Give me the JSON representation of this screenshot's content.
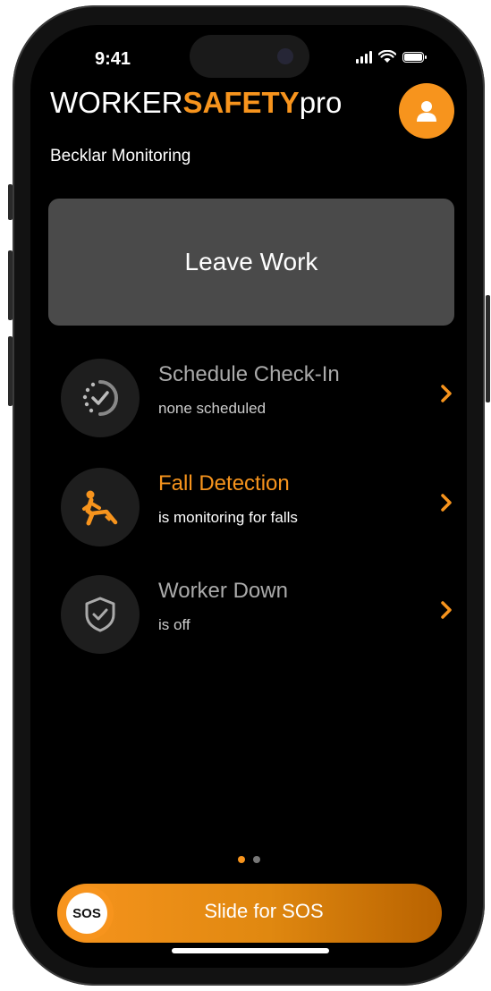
{
  "status_bar": {
    "time": "9:41",
    "icons": [
      "signal-icon",
      "wifi-icon",
      "battery-icon"
    ]
  },
  "header": {
    "brand_prefix": "WORKER",
    "brand_accent": "SAFETY",
    "brand_suffix": "pro",
    "subtitle": "Becklar Monitoring",
    "avatar_icon": "user-icon"
  },
  "main_button": {
    "label": "Leave Work"
  },
  "features": [
    {
      "title": "Schedule Check-In",
      "subtitle": "none scheduled",
      "icon": "timer-check-icon",
      "active": false
    },
    {
      "title": "Fall Detection",
      "subtitle": "is monitoring for falls",
      "icon": "falling-person-icon",
      "active": true
    },
    {
      "title": "Worker Down",
      "subtitle": "is off",
      "icon": "shield-check-icon",
      "active": false
    }
  ],
  "pagination": {
    "current": 1,
    "total": 2
  },
  "sos": {
    "knob_label": "SOS",
    "slider_label": "Slide for SOS"
  },
  "colors": {
    "accent": "#f7941d",
    "background": "#000000",
    "button_gray": "#4a4a4a"
  }
}
